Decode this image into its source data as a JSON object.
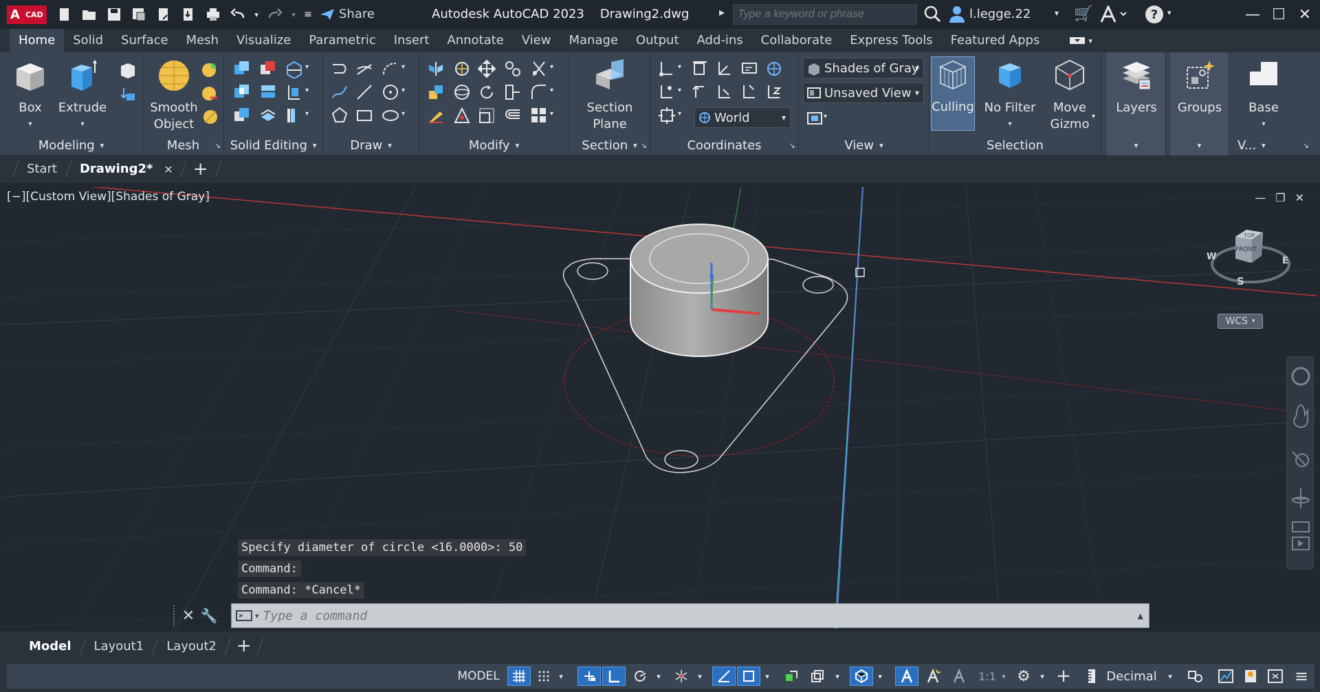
{
  "titlebar": {
    "logo_main": "A",
    "logo_sub": "CAD",
    "share_label": "Share",
    "app_title": "Autodesk AutoCAD 2023    Drawing2.dwg",
    "search_placeholder": "Type a keyword or phrase",
    "username": "l.legge.22",
    "help": "?"
  },
  "ribbon_tabs": [
    "Home",
    "Solid",
    "Surface",
    "Mesh",
    "Visualize",
    "Parametric",
    "Insert",
    "Annotate",
    "View",
    "Manage",
    "Output",
    "Add-ins",
    "Collaborate",
    "Express Tools",
    "Featured Apps"
  ],
  "ribbon": {
    "modeling": {
      "title": "Modeling",
      "box": "Box",
      "extrude": "Extrude"
    },
    "mesh": {
      "title": "Mesh",
      "smooth_line1": "Smooth",
      "smooth_line2": "Object"
    },
    "solid_editing": {
      "title": "Solid Editing"
    },
    "draw": {
      "title": "Draw"
    },
    "modify": {
      "title": "Modify"
    },
    "section": {
      "title": "Section",
      "plane_line1": "Section",
      "plane_line2": "Plane"
    },
    "coordinates": {
      "title": "Coordinates",
      "ucs_value": "World"
    },
    "view": {
      "title": "View",
      "visual_style": "Shades of Gray",
      "saved_view": "Unsaved View"
    },
    "selection": {
      "title": "Selection",
      "culling": "Culling",
      "no_filter": "No Filter",
      "gizmo_line1": "Move",
      "gizmo_line2": "Gizmo"
    },
    "layers": {
      "label": "Layers"
    },
    "groups": {
      "label": "Groups"
    },
    "base": {
      "label": "Base",
      "title": "V..."
    }
  },
  "doc_tabs": {
    "start": "Start",
    "drawing": "Drawing2*"
  },
  "viewport": {
    "view_label": "[−][Custom View][Shades of Gray]",
    "viewcube": {
      "top": "TOP",
      "front": "FRONT",
      "w": "W",
      "e": "E",
      "s": "S"
    },
    "wcs": "WCS"
  },
  "command": {
    "history": [
      "Specify diameter of circle <16.0000>: 50",
      "Command:",
      "Command: *Cancel*"
    ],
    "placeholder": "Type a command"
  },
  "layout_tabs": [
    "Model",
    "Layout1",
    "Layout2"
  ],
  "statusbar": {
    "model": "MODEL",
    "scale": "1:1",
    "units": "Decimal"
  },
  "colors": {
    "accent": "#2b6fc0",
    "x_axis": "#e04040",
    "y_axis": "#3fa04a",
    "z_axis": "#3c6fe0",
    "background": "#212830"
  }
}
